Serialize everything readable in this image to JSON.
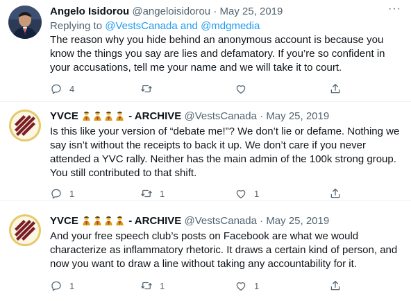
{
  "tweets": [
    {
      "name": "Angelo Isidorou",
      "handle": "@angeloisidorou",
      "separator": "·",
      "date": "May 25, 2019",
      "replying_prefix": "Replying to",
      "replying_to_1": "@VestsCanada",
      "replying_and": "and",
      "replying_to_2": "@mdgmedia",
      "text": "The reason why you hide behind an anonymous account is because you know the things you say are lies and defamatory. If you’re so confident in your accusations, tell me your name and we will take it to court.",
      "reply_count": "4",
      "retweet_count": "",
      "like_count": ""
    },
    {
      "name": "YVCE",
      "name_suffix": "- ARCHIVE",
      "handle": "@VestsCanada",
      "separator": "·",
      "date": "May 25, 2019",
      "text": "Is this like your version of “debate me!”? We don’t lie or defame. Nothing we say isn’t without the receipts to back it up. We don’t care if you never attended a YVC rally. Neither has the main admin of the 100k strong group. You still contributed to that shift.",
      "reply_count": "1",
      "retweet_count": "1",
      "like_count": "1"
    },
    {
      "name": "YVCE",
      "name_suffix": "- ARCHIVE",
      "handle": "@VestsCanada",
      "separator": "·",
      "date": "May 25, 2019",
      "text": "And your free speech club’s posts on Facebook are what we would characterize as inflammatory rhetoric. It draws a certain kind of person, and now you want to draw a line without taking any accountability for it.",
      "reply_count": "1",
      "retweet_count": "1",
      "like_count": "1"
    }
  ],
  "icons": [
    "reply-icon",
    "retweet-icon",
    "like-icon",
    "share-icon",
    "more-icon",
    "vest-person-emoji"
  ],
  "colors": {
    "link": "#1d9bf0",
    "secondary_text": "#536471",
    "logo_maroon": "#7a1d24",
    "logo_ring": "#e6c96a"
  }
}
